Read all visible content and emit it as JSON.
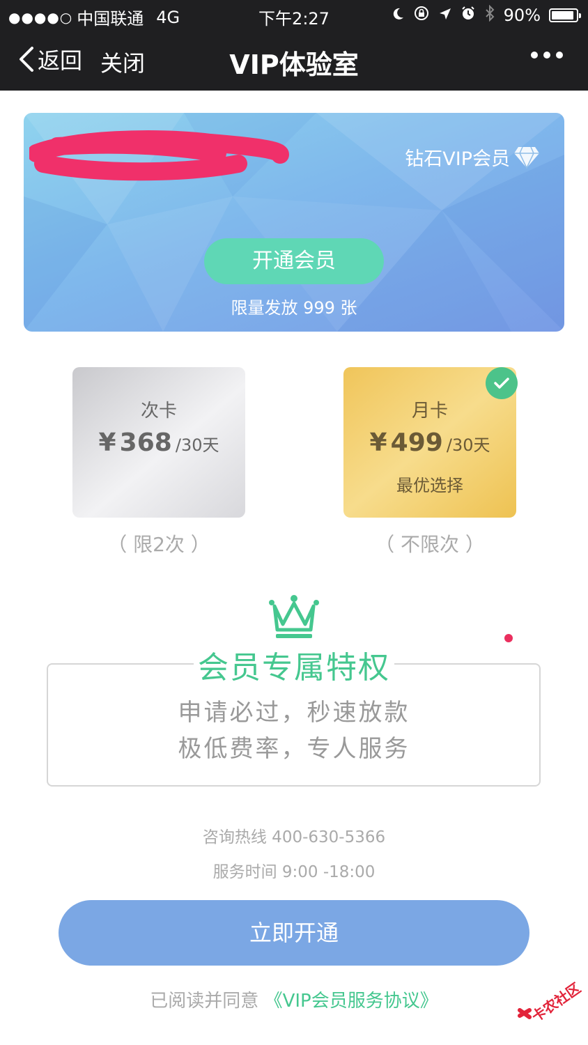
{
  "status_bar": {
    "signal": "●●●●○",
    "carrier": "中国联通",
    "network": "4G",
    "time": "下午2:27",
    "battery_text": "90%",
    "battery_level": 0.9
  },
  "nav": {
    "back_label": "返回",
    "close_label": "关闭",
    "title": "VIP体验室"
  },
  "banner": {
    "tier_label": "钻石VIP会员",
    "open_button": "开通会员",
    "limit_text": "限量发放 999 张"
  },
  "plans": [
    {
      "name": "次卡",
      "currency": "¥",
      "price": "368",
      "unit": "/30天",
      "tag": "",
      "note": "（ 限2次 ）",
      "selected": false
    },
    {
      "name": "月卡",
      "currency": "¥",
      "price": "499",
      "unit": "/30天",
      "tag": "最优选择",
      "note": "（ 不限次 ）",
      "selected": true
    }
  ],
  "privileges": {
    "title": "会员专属特权",
    "lines": [
      "申请必过，秒速放款",
      "极低费率，专人服务"
    ]
  },
  "contact": {
    "hotline": "咨询热线 400-630-5366",
    "hours": "服务时间 9:00 -18:00"
  },
  "cta_label": "立即开通",
  "agreement": {
    "prefix": "已阅读并同意",
    "link": "《VIP会员服务协议》"
  },
  "watermark": "卡农社区",
  "colors": {
    "nav_bg": "#1f1f21",
    "accent_green": "#45c78f",
    "open_button": "#5fd7b5",
    "cta": "#7ba7e4",
    "gold_card": "#f0c55a"
  }
}
